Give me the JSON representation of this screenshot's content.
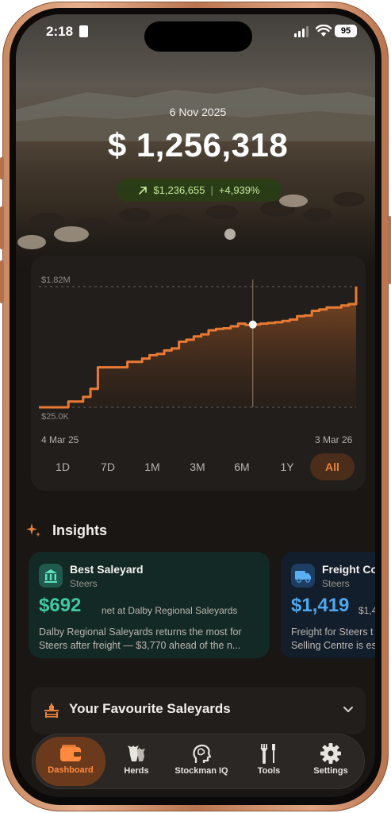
{
  "status_bar": {
    "time": "2:18",
    "battery": "95"
  },
  "hero": {
    "date": "6 Nov 2025",
    "balance": "$ 1,256,318",
    "change_amount": "$1,236,655",
    "change_separator": "|",
    "change_percent": "+4,939%"
  },
  "chart": {
    "y_max_label": "$1.82M",
    "y_min_label": "$25.0K",
    "x_start_label": "4 Mar 25",
    "x_end_label": "3 Mar 26",
    "ranges": [
      "1D",
      "7D",
      "1M",
      "3M",
      "6M",
      "1Y",
      "All"
    ],
    "active_range": "All"
  },
  "chart_data": {
    "type": "area",
    "x_start": "4 Mar 25",
    "x_end": "3 Mar 26",
    "ylim": [
      25000,
      1820000
    ],
    "grid": true,
    "values": [
      25000,
      25000,
      25000,
      25000,
      110000,
      110000,
      180000,
      300000,
      620000,
      620000,
      620000,
      620000,
      700000,
      700000,
      750000,
      800000,
      820000,
      870000,
      900000,
      1000000,
      1030000,
      1080000,
      1110000,
      1170000,
      1190000,
      1200000,
      1230000,
      1270000,
      1250000,
      1256318,
      1270000,
      1280000,
      1290000,
      1310000,
      1330000,
      1380000,
      1390000,
      1460000,
      1480000,
      1510000,
      1510000,
      1540000,
      1560000,
      1820000
    ],
    "selected_point": {
      "value": 1256318,
      "date": "6 Nov 2025"
    }
  },
  "insights": {
    "title": "Insights",
    "cards": [
      {
        "title": "Best Saleyard",
        "subtitle": "Steers",
        "value": "$692",
        "note": "net at Dalby Regional Saleyards",
        "description": "Dalby Regional Saleyards returns the most for Steers after freight — $3,770 ahead of the n...",
        "accent": "#3fc9a2"
      },
      {
        "title": "Freight Co",
        "subtitle": "Steers",
        "value": "$1,419",
        "note": "$1,4",
        "description": "Freight for Steers t Selling Centre is es",
        "accent": "#4ea7ee"
      }
    ]
  },
  "favourites": {
    "title": "Your Favourite Saleyards"
  },
  "tabs": [
    {
      "label": "Dashboard",
      "icon": "wallet-icon"
    },
    {
      "label": "Herds",
      "icon": "cattle-icon"
    },
    {
      "label": "Stockman IQ",
      "icon": "brain-head-icon"
    },
    {
      "label": "Tools",
      "icon": "tools-icon"
    },
    {
      "label": "Settings",
      "icon": "gear-icon"
    }
  ],
  "colors": {
    "accent": "#e8833d",
    "background": "#191614",
    "positive": "#c9eb9d"
  }
}
